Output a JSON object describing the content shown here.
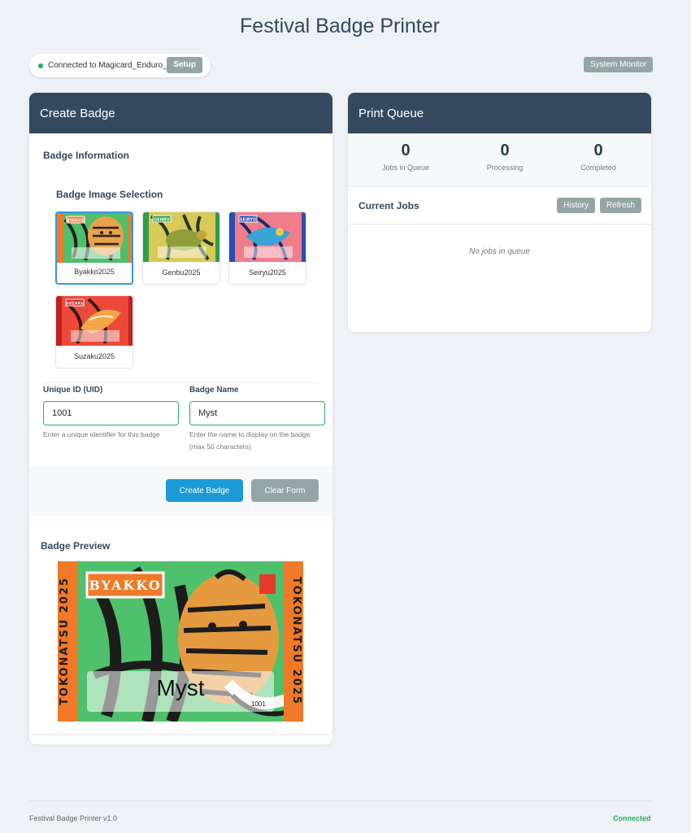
{
  "app": {
    "title": "Festival Badge Printer"
  },
  "connection": {
    "status_text": "Connected to Magicard_Enduro_",
    "setup_label": "Setup",
    "status_color": "#27ae60"
  },
  "system_monitor_label": "System Monitor",
  "create": {
    "header": "Create Badge",
    "section_title": "Badge Information",
    "image_selection_title": "Badge Image Selection",
    "images": [
      {
        "name": "Byakko2025",
        "tag": "BYAKKO",
        "selected": true
      },
      {
        "name": "Genbu2025",
        "tag": "GENBU",
        "selected": false
      },
      {
        "name": "Seiryu2025",
        "tag": "SEIRYŪ",
        "selected": false
      },
      {
        "name": "Suzaku2025",
        "tag": "SUZAKU",
        "selected": false
      }
    ],
    "uid": {
      "label": "Unique ID (UID)",
      "value": "1001",
      "help": "Enter a unique identifier for this badge"
    },
    "name": {
      "label": "Badge Name",
      "value": "Myst",
      "help_line1": "Enter the name to display on the badge",
      "help_line2": "(max 50 characters)"
    },
    "create_button": "Create Badge",
    "clear_button": "Clear Form",
    "preview": {
      "title": "Badge Preview",
      "tag": "BYAKKO",
      "side_text": "TOKONATSU 2025",
      "name": "Myst",
      "uid": "1001"
    }
  },
  "queue": {
    "header": "Print Queue",
    "stats": [
      {
        "value": "0",
        "label": "Jobs in Queue"
      },
      {
        "value": "0",
        "label": "Processing"
      },
      {
        "value": "0",
        "label": "Completed"
      }
    ],
    "jobs_title": "Current Jobs",
    "history_label": "History",
    "refresh_label": "Refresh",
    "empty": "No jobs in queue"
  },
  "footer": {
    "version": "Festival Badge Printer v1.0",
    "status": "Connected"
  }
}
